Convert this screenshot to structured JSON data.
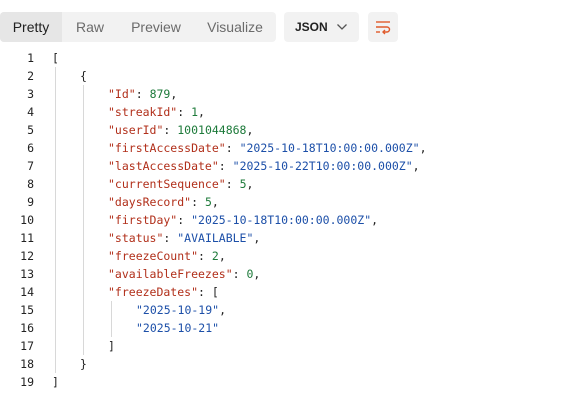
{
  "tabs": [
    {
      "label": "Pretty",
      "active": true
    },
    {
      "label": "Raw",
      "active": false
    },
    {
      "label": "Preview",
      "active": false
    },
    {
      "label": "Visualize",
      "active": false
    }
  ],
  "format": {
    "selected": "JSON"
  },
  "icons": {
    "chevron": "chevron-down-icon",
    "wrap": "word-wrap-icon"
  },
  "colors": {
    "key": "#b12f1a",
    "string": "#1c4fa8",
    "number": "#1d7a3a",
    "wrap_icon": "#e05a2b"
  },
  "line_numbers": [
    "1",
    "2",
    "3",
    "4",
    "5",
    "6",
    "7",
    "8",
    "9",
    "10",
    "11",
    "12",
    "13",
    "14",
    "15",
    "16",
    "17",
    "18",
    "19"
  ],
  "lines": [
    {
      "indent": 0,
      "text": "["
    },
    {
      "indent": 1,
      "text": "{"
    },
    {
      "indent": 2,
      "key": "\"Id\"",
      "value": "879",
      "vtype": "num",
      "comma": true
    },
    {
      "indent": 2,
      "key": "\"streakId\"",
      "value": "1",
      "vtype": "num",
      "comma": true
    },
    {
      "indent": 2,
      "key": "\"userId\"",
      "value": "1001044868",
      "vtype": "num",
      "comma": true
    },
    {
      "indent": 2,
      "key": "\"firstAccessDate\"",
      "value": "\"2025-10-18T10:00:00.000Z\"",
      "vtype": "str",
      "comma": true
    },
    {
      "indent": 2,
      "key": "\"lastAccessDate\"",
      "value": "\"2025-10-22T10:00:00.000Z\"",
      "vtype": "str",
      "comma": true
    },
    {
      "indent": 2,
      "key": "\"currentSequence\"",
      "value": "5",
      "vtype": "num",
      "comma": true
    },
    {
      "indent": 2,
      "key": "\"daysRecord\"",
      "value": "5",
      "vtype": "num",
      "comma": true
    },
    {
      "indent": 2,
      "key": "\"firstDay\"",
      "value": "\"2025-10-18T10:00:00.000Z\"",
      "vtype": "str",
      "comma": true
    },
    {
      "indent": 2,
      "key": "\"status\"",
      "value": "\"AVAILABLE\"",
      "vtype": "str",
      "comma": true
    },
    {
      "indent": 2,
      "key": "\"freezeCount\"",
      "value": "2",
      "vtype": "num",
      "comma": true
    },
    {
      "indent": 2,
      "key": "\"availableFreezes\"",
      "value": "0",
      "vtype": "num",
      "comma": true
    },
    {
      "indent": 2,
      "key": "\"freezeDates\"",
      "value": "[",
      "vtype": "plain",
      "comma": false
    },
    {
      "indent": 3,
      "value": "\"2025-10-19\"",
      "vtype": "str",
      "comma": true
    },
    {
      "indent": 3,
      "value": "\"2025-10-21\"",
      "vtype": "str",
      "comma": false
    },
    {
      "indent": 2,
      "text": "]"
    },
    {
      "indent": 1,
      "text": "}"
    },
    {
      "indent": 0,
      "text": "]"
    }
  ]
}
